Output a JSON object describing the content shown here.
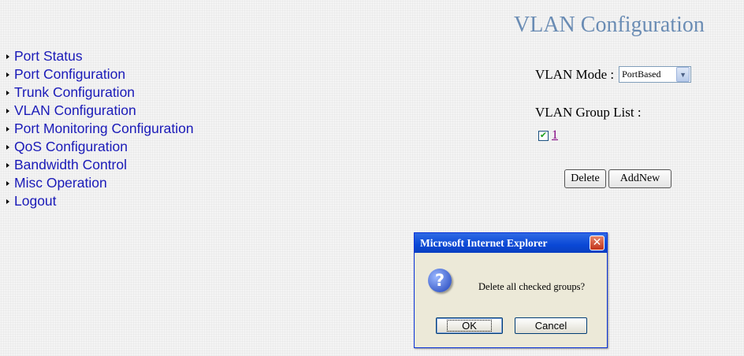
{
  "page": {
    "title": "VLAN Configuration"
  },
  "nav": [
    {
      "label": "Port Status"
    },
    {
      "label": "Port Configuration"
    },
    {
      "label": "Trunk Configuration"
    },
    {
      "label": "VLAN Configuration"
    },
    {
      "label": "Port Monitoring Configuration"
    },
    {
      "label": "QoS Configuration"
    },
    {
      "label": "Bandwidth Control"
    },
    {
      "label": "Misc Operation"
    },
    {
      "label": "Logout"
    }
  ],
  "vlan": {
    "mode_label": "VLAN Mode :",
    "mode_value": "PortBased",
    "group_list_label": "VLAN Group List :",
    "groups": [
      {
        "id": "1",
        "checked": true
      }
    ],
    "delete_label": "Delete",
    "addnew_label": "AddNew"
  },
  "dialog": {
    "title": "Microsoft Internet Explorer",
    "message": "Delete all checked groups?",
    "ok_label": "OK",
    "cancel_label": "Cancel",
    "icon": "question-icon",
    "close_icon": "close-icon"
  },
  "colors": {
    "title": "#6a8cb4",
    "nav_link": "#1a1ab8",
    "visited_link": "#800080",
    "dialog_titlebar": "#0a48d6"
  }
}
